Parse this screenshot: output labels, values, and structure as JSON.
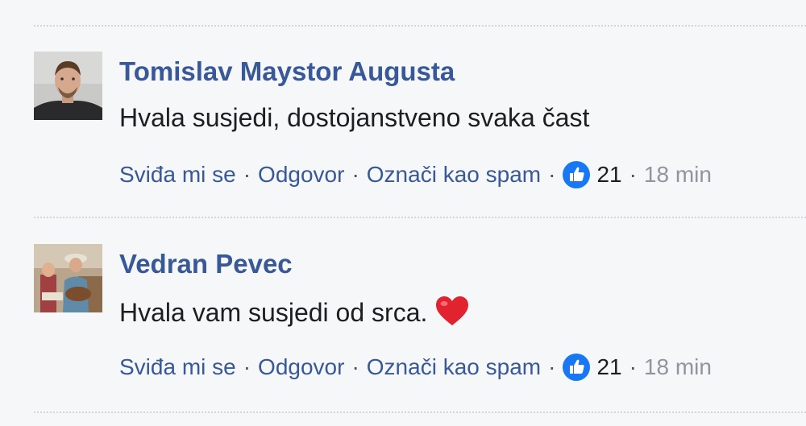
{
  "comments": [
    {
      "author": "Tomislav Maystor Augusta",
      "text": "Hvala susjedi, dostojanstveno svaka čast",
      "emoji": "",
      "actions": {
        "like": "Sviđa mi se",
        "reply": "Odgovor",
        "spam": "Označi kao spam"
      },
      "separator": "·",
      "like_count": "21",
      "time": "18 min"
    },
    {
      "author": "Vedran Pevec",
      "text": "Hvala vam susjedi od srca.",
      "emoji": "heart-emoji",
      "actions": {
        "like": "Sviđa mi se",
        "reply": "Odgovor",
        "spam": "Označi kao spam"
      },
      "separator": "·",
      "like_count": "21",
      "time": "18 min"
    }
  ],
  "colors": {
    "author": "#385898",
    "link": "#385898",
    "text": "#1c1e21",
    "meta": "#90949c",
    "like_badge": "#1877f2"
  }
}
